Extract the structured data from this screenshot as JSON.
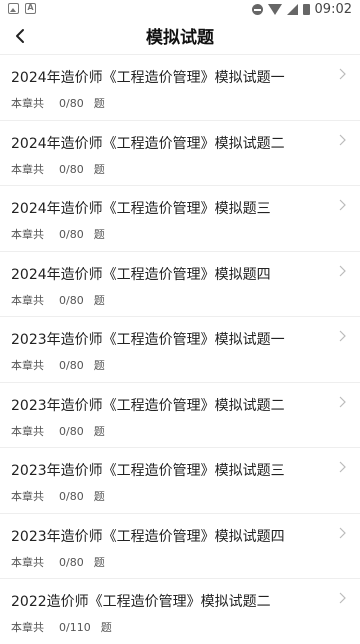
{
  "status_bar": {
    "time": "09:02",
    "icons": [
      "image-icon",
      "a-icon",
      "dnd-icon",
      "wifi-icon",
      "signal-icon",
      "battery-icon"
    ]
  },
  "header": {
    "title": "模拟试题",
    "back_icon": "chevron-left-icon"
  },
  "items": [
    {
      "title": "2024年造价师《工程造价管理》模拟试题一",
      "prefix": "本章共",
      "progress": "0/80",
      "suffix": "题"
    },
    {
      "title": "2024年造价师《工程造价管理》模拟试题二",
      "prefix": "本章共",
      "progress": "0/80",
      "suffix": "题"
    },
    {
      "title": "2024年造价师《工程造价管理》模拟题三",
      "prefix": "本章共",
      "progress": "0/80",
      "suffix": "题"
    },
    {
      "title": "2024年造价师《工程造价管理》模拟题四",
      "prefix": "本章共",
      "progress": "0/80",
      "suffix": "题"
    },
    {
      "title": "2023年造价师《工程造价管理》模拟试题一",
      "prefix": "本章共",
      "progress": "0/80",
      "suffix": "题"
    },
    {
      "title": "2023年造价师《工程造价管理》模拟试题二",
      "prefix": "本章共",
      "progress": "0/80",
      "suffix": "题"
    },
    {
      "title": "2023年造价师《工程造价管理》模拟试题三",
      "prefix": "本章共",
      "progress": "0/80",
      "suffix": "题"
    },
    {
      "title": "2023年造价师《工程造价管理》模拟试题四",
      "prefix": "本章共",
      "progress": "0/80",
      "suffix": "题"
    },
    {
      "title": "2022造价师《工程造价管理》模拟试题二",
      "prefix": "本章共",
      "progress": "0/110",
      "suffix": "题"
    }
  ]
}
